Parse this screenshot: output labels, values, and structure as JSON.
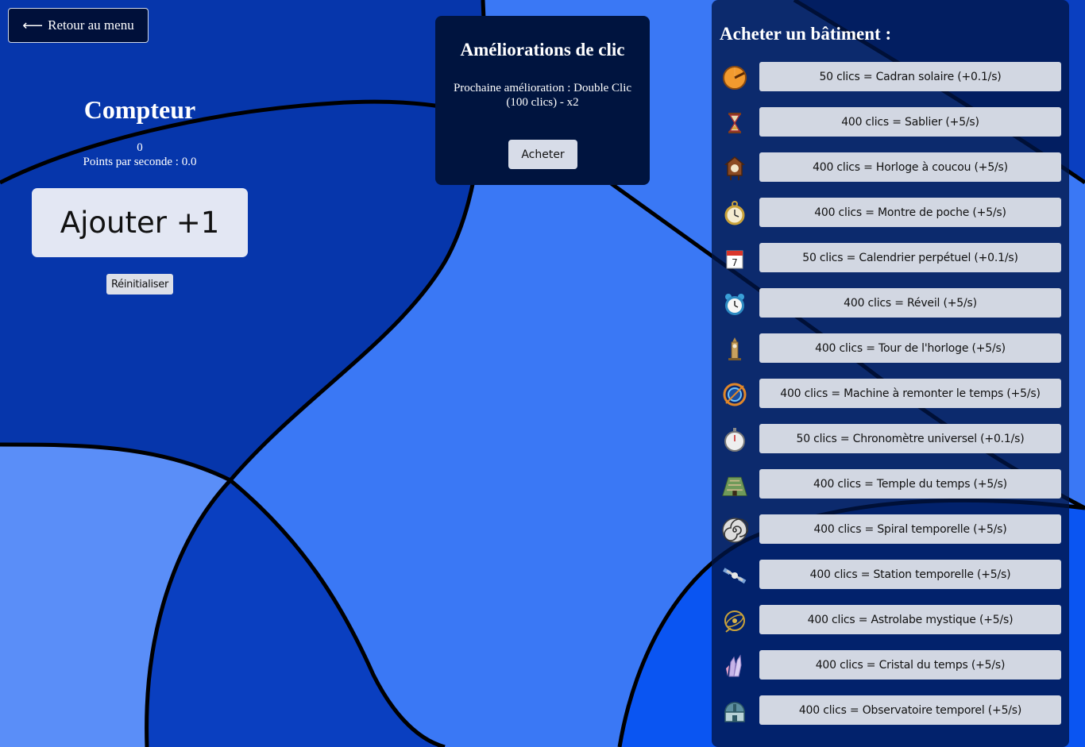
{
  "nav": {
    "back_label": "Retour au menu"
  },
  "counter": {
    "title": "Compteur",
    "value": "0",
    "pps": "Points par seconde : 0.0",
    "add_label": "Ajouter +1",
    "reset_label": "Réinitialiser"
  },
  "upgrade": {
    "title": "Améliorations de clic",
    "next": "Prochaine amélioration : Double Clic (100 clics) - x2",
    "buy_label": "Acheter"
  },
  "shop": {
    "title": "Acheter un bâtiment :",
    "items": [
      {
        "icon": "sundial-icon",
        "label": "50 clics = Cadran solaire (+0.1/s)"
      },
      {
        "icon": "hourglass-icon",
        "label": "400 clics = Sablier (+5/s)"
      },
      {
        "icon": "cuckoo-clock-icon",
        "label": "400 clics = Horloge à coucou (+5/s)"
      },
      {
        "icon": "pocket-watch-icon",
        "label": "400 clics = Montre de poche (+5/s)"
      },
      {
        "icon": "calendar-icon",
        "label": "50 clics = Calendrier perpétuel (+0.1/s)"
      },
      {
        "icon": "alarm-clock-icon",
        "label": "400 clics = Réveil (+5/s)"
      },
      {
        "icon": "clock-tower-icon",
        "label": "400 clics = Tour de l'horloge (+5/s)"
      },
      {
        "icon": "time-machine-icon",
        "label": "400 clics = Machine à remonter le temps (+5/s)"
      },
      {
        "icon": "stopwatch-icon",
        "label": "50 clics = Chronomètre universel (+0.1/s)"
      },
      {
        "icon": "temple-icon",
        "label": "400 clics = Temple du temps (+5/s)"
      },
      {
        "icon": "spiral-icon",
        "label": "400 clics = Spiral temporelle (+5/s)"
      },
      {
        "icon": "space-station-icon",
        "label": "400 clics = Station temporelle (+5/s)"
      },
      {
        "icon": "astrolabe-icon",
        "label": "400 clics = Astrolabe mystique (+5/s)"
      },
      {
        "icon": "crystal-icon",
        "label": "400 clics = Cristal du temps (+5/s)"
      },
      {
        "icon": "observatory-icon",
        "label": "400 clics = Observatoire temporel (+5/s)"
      }
    ]
  },
  "colors": {
    "background_light": "#3a78f5",
    "background_dark": "#0036a8",
    "panel_dark": "#00143f",
    "button_light": "#d2d7e2"
  }
}
